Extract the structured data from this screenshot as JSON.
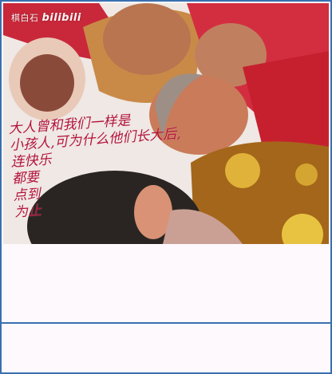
{
  "watermark": {
    "channel": "棋白石",
    "brand": "bilibili"
  },
  "caption": {
    "lines": [
      "大人曾和我们一样是",
      "小孩人,可为什么他们长大后,",
      "连快乐",
      "都要",
      "点到",
      "为止"
    ]
  }
}
